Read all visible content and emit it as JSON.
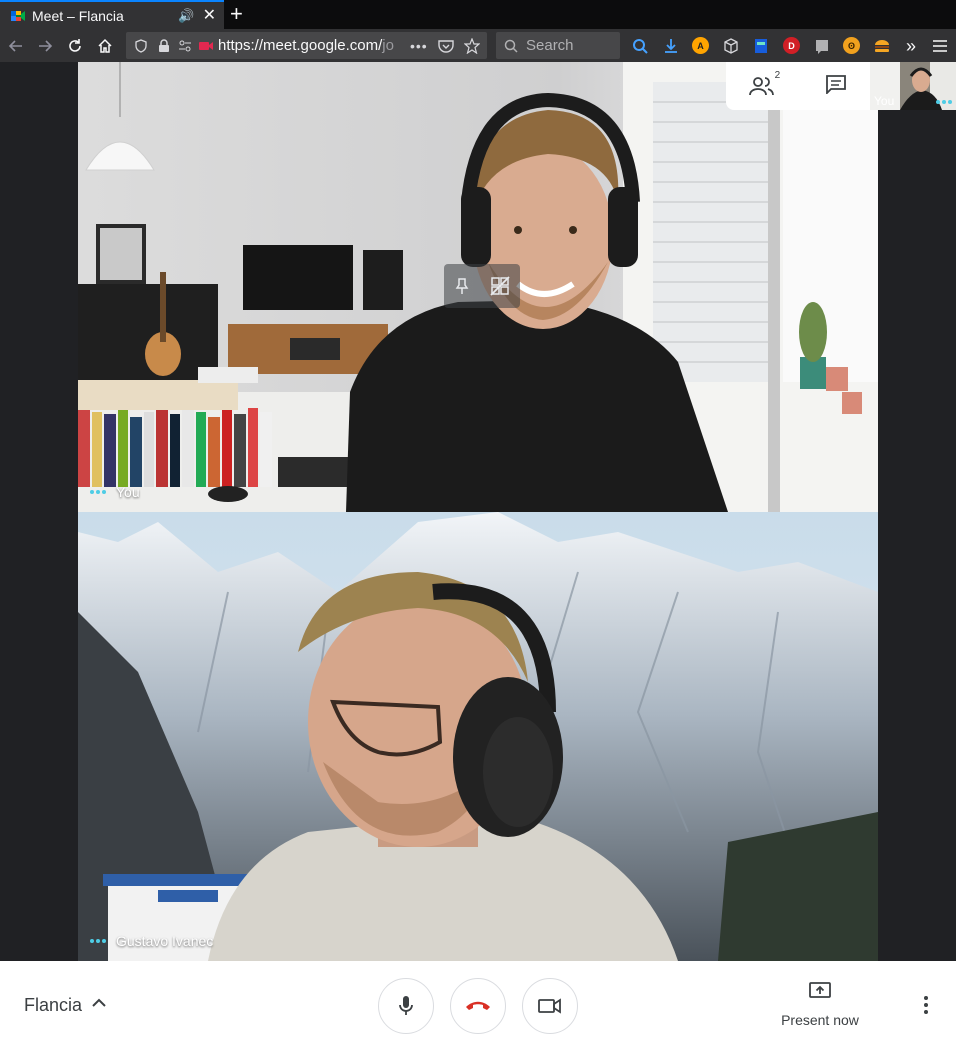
{
  "browser": {
    "tab": {
      "title": "Meet – Flancia"
    },
    "url": {
      "prefix": "https://meet.google.com/",
      "suffix": "jo"
    },
    "search": {
      "placeholder": "Search"
    },
    "accent_color": "#0a84ff"
  },
  "meet": {
    "participants_count": "2",
    "self_thumb_label": "You",
    "tiles": [
      {
        "name": "You"
      },
      {
        "name": "Gustavo Ivanec"
      }
    ],
    "meeting_name": "Flancia",
    "present_label": "Present now",
    "hangup_color": "#d93025",
    "speaking_dot_color": "#4ecde6"
  }
}
